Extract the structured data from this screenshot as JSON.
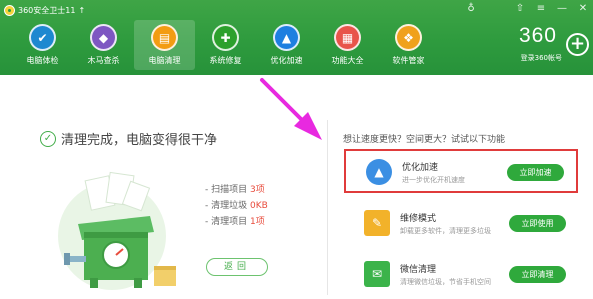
{
  "titlebar": {
    "app_title": "360安全卫士11",
    "title_arrow": "↑",
    "controls": {
      "skin": "♁",
      "up": "⇧",
      "menu": "≡",
      "minimize": "—",
      "close": "✕"
    }
  },
  "nav": {
    "items": [
      {
        "label": "电脑体检",
        "icon": "monitor-icon",
        "glyph": "✔",
        "color": "#1e88d0"
      },
      {
        "label": "木马查杀",
        "icon": "horse-icon",
        "glyph": "◆",
        "color": "#7e57c2"
      },
      {
        "label": "电脑清理",
        "icon": "broom-icon",
        "glyph": "▤",
        "color": "#f39c12"
      },
      {
        "label": "系统修复",
        "icon": "shield-icon",
        "glyph": "✚",
        "color": "#2ca02c"
      },
      {
        "label": "优化加速",
        "icon": "rocket-icon",
        "glyph": "▲",
        "color": "#1e7fe0"
      },
      {
        "label": "功能大全",
        "icon": "grid-icon",
        "glyph": "▦",
        "color": "#e8544a"
      },
      {
        "label": "软件管家",
        "icon": "apps-icon",
        "glyph": "❖",
        "color": "#f0a11c"
      }
    ],
    "active_index": 2
  },
  "brand": {
    "logo_text": "360",
    "account_label": "登录360帐号",
    "plus": "+"
  },
  "result": {
    "title": "清理完成，电脑变得很干净",
    "check": "✓",
    "stats": [
      {
        "label": "- 扫描项目",
        "value": "3项"
      },
      {
        "label": "- 清理垃圾",
        "value": "0KB"
      },
      {
        "label": "- 清理项目",
        "value": "1项"
      }
    ],
    "back_button": "返回"
  },
  "recommend": {
    "title": "想让速度更快？空间更大？试试以下功能",
    "features": [
      {
        "name": "优化加速",
        "desc": "进一步优化开机速度",
        "button": "立即加速",
        "icon": "rocket-icon",
        "glyph": "▲",
        "icon_color": "#3b8fe3",
        "highlighted": true
      },
      {
        "name": "维修模式",
        "desc": "卸载更多软件，清理更多垃圾",
        "button": "立即使用",
        "icon": "wrench-icon",
        "glyph": "✎",
        "icon_color": "#f2b22a",
        "highlighted": false
      },
      {
        "name": "微信清理",
        "desc": "清理微信垃圾，节省手机空间",
        "button": "立即清理",
        "icon": "wechat-icon",
        "glyph": "✉",
        "icon_color": "#3bb34a",
        "highlighted": false
      }
    ]
  },
  "colors": {
    "header_green": "#2e9b3e",
    "button_green": "#2fa93c",
    "highlight_red": "#e03b3b",
    "arrow_magenta": "#e829e0",
    "stat_value_red": "#e84c3d"
  }
}
